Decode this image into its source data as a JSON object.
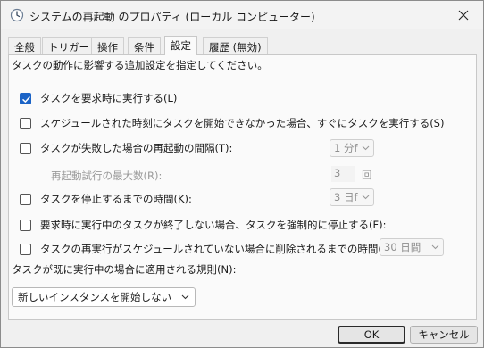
{
  "window": {
    "title": "システムの再起動 のプロパティ (ローカル コンピューター)"
  },
  "tabs": [
    {
      "label": "全般"
    },
    {
      "label": "トリガー"
    },
    {
      "label": "操作"
    },
    {
      "label": "条件"
    },
    {
      "label": "設定",
      "active": true
    },
    {
      "label": "履歴 (無効)"
    }
  ],
  "settings": {
    "intro": "タスクの動作に影響する追加設定を指定してください。",
    "allow_on_demand": {
      "label": "タスクを要求時に実行する(L)",
      "checked": true
    },
    "run_missed": {
      "label": "スケジュールされた時刻にタスクを開始できなかった場合、すぐにタスクを実行する(S)",
      "checked": false
    },
    "restart_on_fail": {
      "label": "タスクが失敗した場合の再起動の間隔(T):",
      "checked": false,
      "value": "1 分f"
    },
    "restart_attempts": {
      "label": "再起動試行の最大数(R):",
      "value": "3",
      "unit": "回"
    },
    "stop_after": {
      "label": "タスクを停止するまでの時間(K):",
      "checked": false,
      "value": "3 日f"
    },
    "force_stop": {
      "label": "要求時に実行中のタスクが終了しない場合、タスクを強制的に停止する(F):",
      "checked": false
    },
    "delete_after": {
      "label": "タスクの再実行がスケジュールされていない場合に削除されるまでの時間(D):",
      "checked": false,
      "value": "30 日間"
    },
    "rule_label": "タスクが既に実行中の場合に適用される規則(N):",
    "rule_value": "新しいインスタンスを開始しない"
  },
  "buttons": {
    "ok": "OK",
    "cancel": "キャンセル"
  },
  "icons": {
    "title": "clock-icon",
    "close": "close-icon",
    "check": "checkmark-icon",
    "dropdown": "chevron-down-icon"
  },
  "colors": {
    "accent": "#1b63c6"
  }
}
